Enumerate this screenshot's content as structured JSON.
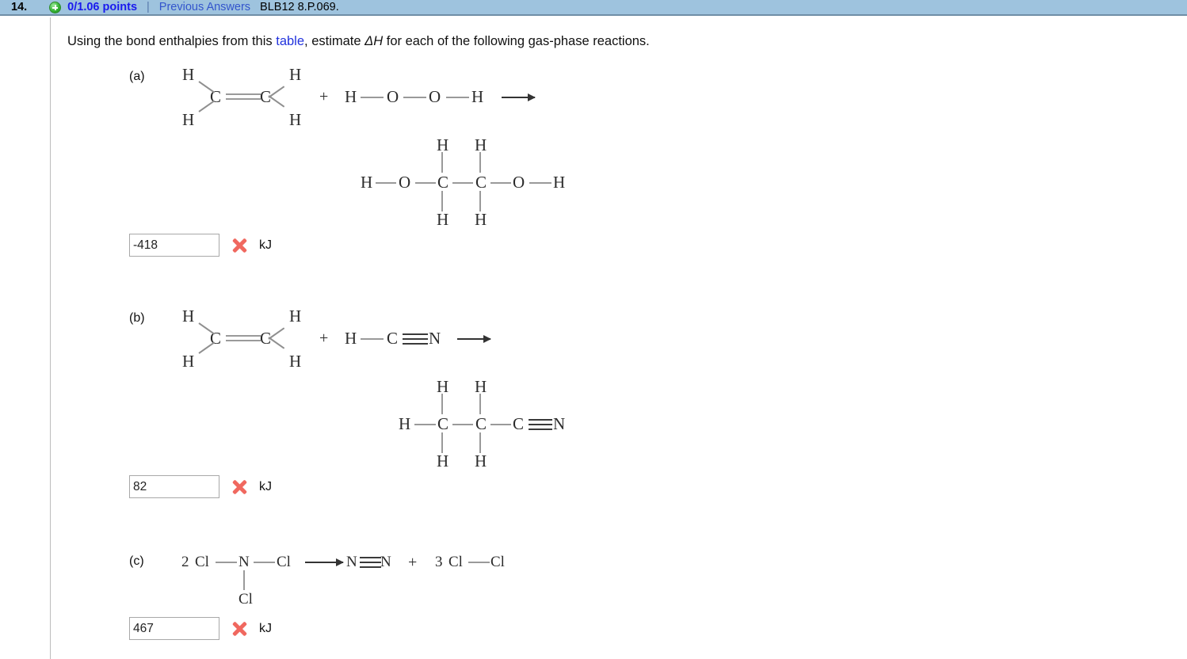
{
  "header": {
    "question_number": "14.",
    "plus_icon": "plus-circle-icon",
    "points": "0/1.06 points",
    "pipe": "|",
    "previous_answers": "Previous Answers",
    "question_code": "BLB12 8.P.069.",
    "bar_color": "#9ec3de",
    "points_color": "#1a1aee",
    "link_color": "#3355cc"
  },
  "prompt": {
    "text_before_link": "Using the bond enthalpies from this ",
    "link_text": "table",
    "text_after_link": ", estimate ",
    "delta_h": "ΔH",
    "text_tail": " for each of the following gas-phase reactions."
  },
  "parts": [
    {
      "label": "(a)",
      "reactant1_name": "ethene",
      "reactant2_name": "hydrogen-peroxide",
      "product_name": "ethylene-glycol",
      "atoms": {
        "h_tl": "H",
        "h_bl": "H",
        "c_l": "C",
        "c_r": "C",
        "h_tr": "H",
        "h_br": "H",
        "plus": "+",
        "p_h1": "H",
        "p_o1": "O",
        "p_o2": "O",
        "p_h2": "H",
        "pr_h_left": "H",
        "pr_o_left": "O",
        "pr_c1": "C",
        "pr_c2": "C",
        "pr_o_right": "O",
        "pr_h_right": "H",
        "pr_h_t1": "H",
        "pr_h_t2": "H",
        "pr_h_b1": "H",
        "pr_h_b2": "H"
      },
      "answer_value": "-418",
      "answer_status": "incorrect",
      "unit": "kJ"
    },
    {
      "label": "(b)",
      "reactant1_name": "ethene",
      "reactant2_name": "hydrogen-cyanide",
      "product_name": "propanenitrile",
      "atoms": {
        "h_tl": "H",
        "h_bl": "H",
        "c_l": "C",
        "c_r": "C",
        "h_tr": "H",
        "h_br": "H",
        "plus": "+",
        "p_h1": "H",
        "p_c1": "C",
        "p_n1": "N",
        "pr_h_left": "H",
        "pr_c1": "C",
        "pr_c2": "C",
        "pr_c3": "C",
        "pr_n": "N",
        "pr_h_t1": "H",
        "pr_h_t2": "H",
        "pr_h_b1": "H",
        "pr_h_b2": "H"
      },
      "answer_value": "82",
      "answer_status": "incorrect",
      "unit": "kJ"
    },
    {
      "label": "(c)",
      "reactant1_name": "nitrogen-trichloride",
      "product_name": "nitrogen-and-chlorine",
      "atoms": {
        "coeff2": "2",
        "cl_left": "Cl",
        "n_center": "N",
        "cl_right": "Cl",
        "cl_bottom": "Cl",
        "n1": "N",
        "n2": "N",
        "plus": "+",
        "coeff3": "3",
        "cl_a": "Cl",
        "cl_b": "Cl"
      },
      "answer_value": "467",
      "answer_status": "incorrect",
      "unit": "kJ"
    }
  ],
  "colors": {
    "bond_gray": "#9a9a9a",
    "atom_text": "#2b2b2b",
    "xmark_red": "#f0685f",
    "input_border": "#a8a8a8"
  }
}
